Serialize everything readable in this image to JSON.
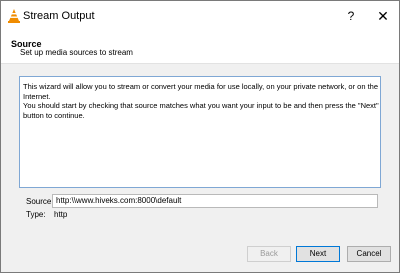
{
  "window": {
    "title": "Stream Output",
    "help_label": "?",
    "close_label": "✕"
  },
  "header": {
    "title": "Source",
    "subtitle": "Set up media sources to stream"
  },
  "description": "This wizard will allow you to stream or convert your media for use locally, on your private network, or on the Internet.\nYou should start by checking that source matches what you want your input to be and then press the \"Next\" button to continue.",
  "source": {
    "label": "Source:",
    "value": "http:\\\\www.hiveks.com:8000\\default"
  },
  "type": {
    "label": "Type:",
    "value": "http"
  },
  "buttons": {
    "back": "Back",
    "next": "Next",
    "cancel": "Cancel"
  },
  "colors": {
    "accent": "#0078d7",
    "vlc_orange": "#f08c00"
  }
}
